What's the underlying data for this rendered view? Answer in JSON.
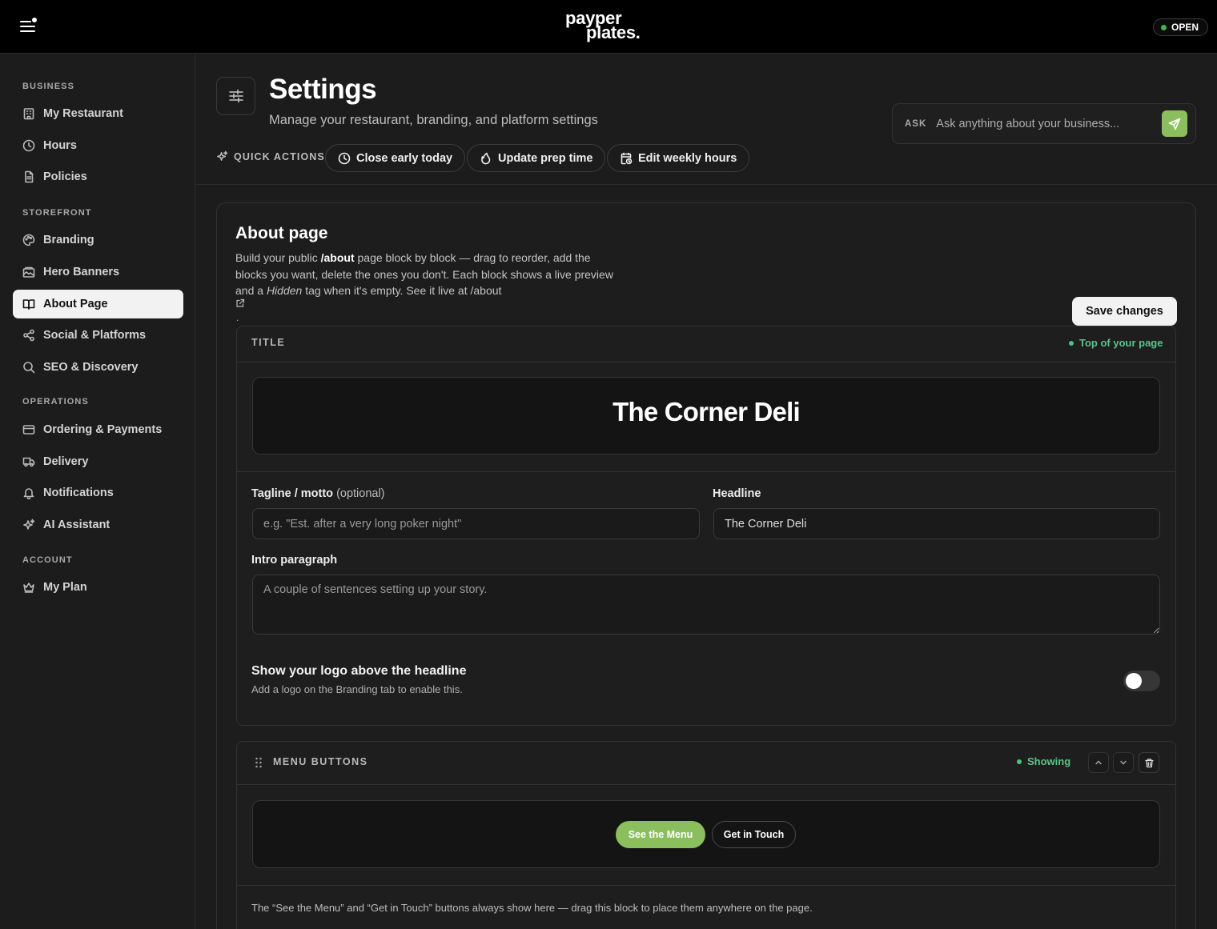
{
  "topbar": {
    "logo_line1": "payper",
    "logo_line2": "plates.",
    "status": "OPEN",
    "status_color": "#4caf50"
  },
  "sidebar": {
    "sections": [
      {
        "title": "BUSINESS",
        "items": [
          {
            "label": "My Restaurant",
            "icon": "building-icon"
          },
          {
            "label": "Hours",
            "icon": "clock-icon"
          },
          {
            "label": "Policies",
            "icon": "document-icon"
          }
        ]
      },
      {
        "title": "STOREFRONT",
        "items": [
          {
            "label": "Branding",
            "icon": "palette-icon"
          },
          {
            "label": "Hero Banners",
            "icon": "image-icon"
          },
          {
            "label": "About Page",
            "icon": "book-open-icon",
            "active": true
          },
          {
            "label": "Social & Platforms",
            "icon": "share-icon"
          },
          {
            "label": "SEO & Discovery",
            "icon": "search-icon"
          }
        ]
      },
      {
        "title": "OPERATIONS",
        "items": [
          {
            "label": "Ordering & Payments",
            "icon": "credit-card-icon"
          },
          {
            "label": "Delivery",
            "icon": "truck-icon"
          },
          {
            "label": "Notifications",
            "icon": "bell-icon"
          },
          {
            "label": "AI Assistant",
            "icon": "sparkles-icon"
          }
        ]
      },
      {
        "title": "ACCOUNT",
        "items": [
          {
            "label": "My Plan",
            "icon": "crown-icon"
          }
        ]
      }
    ]
  },
  "header": {
    "title": "Settings",
    "subtitle": "Manage your restaurant, branding, and platform settings",
    "ask_label": "ASK",
    "ask_placeholder": "Ask anything about your business...",
    "quick_actions_label": "QUICK ACTIONS",
    "quick_actions": [
      {
        "label": "Close early today",
        "icon": "clock-icon"
      },
      {
        "label": "Update prep time",
        "icon": "flame-icon"
      },
      {
        "label": "Edit weekly hours",
        "icon": "calendar-clock-icon"
      }
    ]
  },
  "about": {
    "title": "About page",
    "desc_1": "Build your public ",
    "desc_path": "/about",
    "desc_2": " page block by block — drag to reorder, add the blocks you want, delete the ones you don't. Each block shows a live preview and a ",
    "desc_hidden": "Hidden",
    "desc_3": " tag when it's empty. See it live at /about",
    "desc_trailing": ".",
    "save_label": "Save changes",
    "title_block": {
      "label": "TITLE",
      "status": "Top of your page",
      "preview_headline": "The Corner Deli",
      "tagline_label": "Tagline / motto",
      "tagline_optional": "(optional)",
      "tagline_placeholder": "e.g. \"Est. after a very long poker night\"",
      "headline_label": "Headline",
      "headline_value": "The Corner Deli",
      "intro_label": "Intro paragraph",
      "intro_placeholder": "A couple of sentences setting up your story.",
      "logo_toggle_title": "Show your logo above the headline",
      "logo_toggle_sub": "Add a logo on the Branding tab to enable this.",
      "logo_toggle_on": false
    },
    "menu_block": {
      "label": "MENU BUTTONS",
      "status": "Showing",
      "primary_button": "See the Menu",
      "secondary_button": "Get in Touch",
      "note": "The “See the Menu” and “Get in Touch” buttons always show here — drag this block to place them anywhere on the page."
    }
  },
  "colors": {
    "accent_green": "#8bbf5e",
    "status_green": "#5cc38a",
    "background": "#1c1c1c"
  }
}
